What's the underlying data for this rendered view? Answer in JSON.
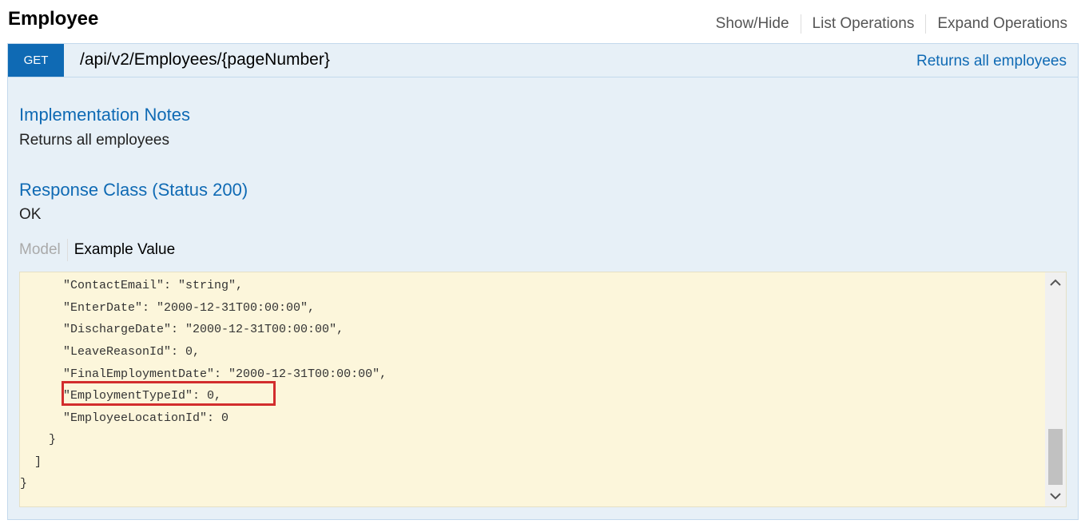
{
  "resource": {
    "title": "Employee",
    "actions": [
      "Show/Hide",
      "List Operations",
      "Expand Operations"
    ]
  },
  "operation": {
    "method": "GET",
    "path": "/api/v2/Employees/{pageNumber}",
    "summary": "Returns all employees",
    "implementation_notes": {
      "title": "Implementation Notes",
      "text": "Returns all employees"
    },
    "response_class": {
      "title": "Response Class (Status 200)",
      "text": "OK"
    },
    "model_tabs": {
      "model": "Model",
      "example": "Example Value"
    },
    "code_lines": [
      "      \"ContactEmail\": \"string\",",
      "      \"EnterDate\": \"2000-12-31T00:00:00\",",
      "      \"DischargeDate\": \"2000-12-31T00:00:00\",",
      "      \"LeaveReasonId\": 0,",
      "      \"FinalEmploymentDate\": \"2000-12-31T00:00:00\",",
      "      \"EmploymentTypeId\": 0,",
      "      \"EmployeeLocationId\": 0",
      "    }",
      "  ]",
      "}"
    ],
    "highlighted_line": "\"EmploymentTypeId\": 0,"
  },
  "colors": {
    "method_get": "#0f6ab4",
    "link_blue": "#0f6ab4",
    "operation_bg": "#e7f0f7",
    "code_bg": "#fcf6db",
    "highlight_border": "#d22d2d"
  },
  "icons": {
    "scroll_up": "chevron-up-icon",
    "scroll_down": "chevron-down-icon"
  }
}
